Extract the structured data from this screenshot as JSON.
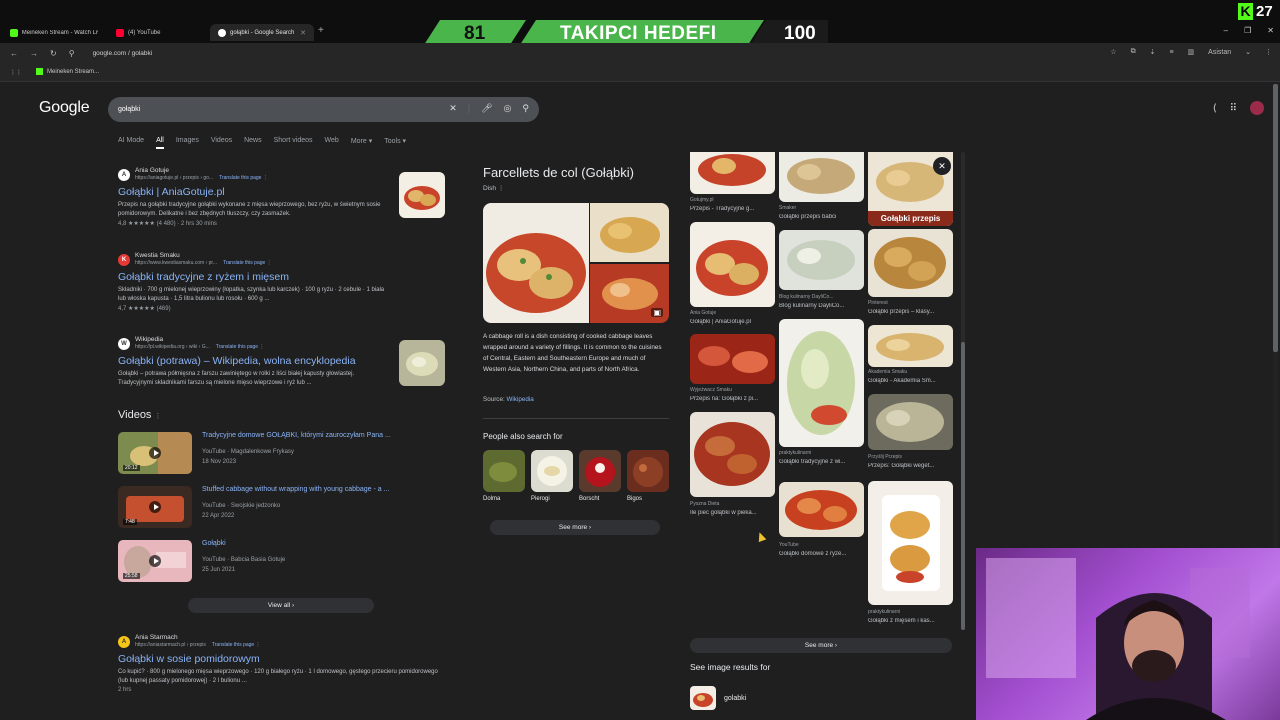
{
  "browser": {
    "tabs": [
      {
        "label": "Meineken Stream - Watch Liv"
      },
      {
        "label": "(4) YouTube"
      },
      {
        "label": "gołąbki - Google Search"
      }
    ],
    "url": "google.com / golabki",
    "bookmark": "Meineken Stream...",
    "assistant_label": "Asistan"
  },
  "overlay": {
    "goal_current": "81",
    "goal_text": "TAKIPCI HEDEFI",
    "goal_target": "100",
    "kick_count": "27"
  },
  "google": {
    "logo": "Google",
    "query": "gołąbki",
    "tabs": [
      "AI Mode",
      "All",
      "Images",
      "Videos",
      "News",
      "Short videos",
      "Web",
      "More ▾",
      "Tools ▾"
    ]
  },
  "results": [
    {
      "site": "Ania Gotuje",
      "url": "https://aniagotuje.pl › przepis › go...",
      "translate": "Translate this page",
      "title": "Gołąbki | AniaGotuje.pl",
      "snippet_lead": "Przepis na gołąbki tradycyjne gołąbki wykonane z mięsa wieprzowego, bez ryżu, w świetnym sosie pomidorowym. Delikatne i bez zbędnych tłuszczy, czy zasmażek.",
      "meta": "4,8 ★★★★★ (4 480) · 2 hrs 30 mins"
    },
    {
      "site": "Kwestia Smaku",
      "url": "https://www.kwestiasmaku.com › pr...",
      "translate": "Translate this page",
      "title": "Gołąbki tradycyjne z ryżem i mięsem",
      "snippet_lead": "Składniki · 700 g mielonej wieprzowiny (łopatka, szynka lub karczek) · 100 g ryżu · 2 cebule · 1 biała lub włoska kapusta · 1,5 litra bulionu lub rosołu · 600 g ...",
      "meta": "4,7 ★★★★★ (469)"
    },
    {
      "site": "Wikipedia",
      "url": "https://pl.wikipedia.org › wiki › G...",
      "translate": "Translate this page",
      "title": "Gołąbki (potrawa) – Wikipedia, wolna encyklopedia",
      "snippet_lead": "Gołąbki – potrawa półmięsna z farszu zawiniętego w rolki z liści białej kapusty głowiastej. Tradycyjnymi składnikami farszu są mielone mięso wieprzowe i ryż lub ...",
      "meta": ""
    }
  ],
  "videos": {
    "heading": "Videos",
    "items": [
      {
        "title": "Tradycyjne domowe GOŁĄBKI, którymi zauroczyłam Pana ...",
        "source": "YouTube · Magdalenkowe Frykasy",
        "date": "18 Nov 2023",
        "duration": "20:12"
      },
      {
        "title": "Stuffed cabbage without wrapping with young cabbage - a ...",
        "source": "YouTube · Swojskie jedzonko",
        "date": "22 Apr 2022",
        "duration": "7:48"
      },
      {
        "title": "Gołąbki",
        "source": "YouTube · Babcia Basia Gotuje",
        "date": "25 Jun 2021",
        "duration": "25:58"
      }
    ],
    "view_all": "View all ›"
  },
  "result4": {
    "site": "Ania Starmach",
    "url": "https://aniastarmach.pl › przepis",
    "translate": "Translate this page",
    "title": "Gołąbki w sosie pomidorowym",
    "snippet": "Co kupić? · 800 g mielonego mięsa wieprzowego · 120 g białego ryżu · 1 l domowego, gęstego przecieru pomidorowego (lub kupnej passaty pomidorowej) · 2 l bulionu ...",
    "meta": "2 hrs"
  },
  "knowledge_panel": {
    "title": "Farcellets de col (Gołąbki)",
    "subtitle": "Dish",
    "description": "A cabbage roll is a dish consisting of cooked cabbage leaves wrapped around a variety of fillings. It is common to the cuisines of Central, Eastern and Southeastern Europe and much of Western Asia, Northern China, and parts of North Africa.",
    "source_label": "Source:",
    "source_link": "Wikipedia",
    "people_also_search": "People also search for",
    "related": [
      "Dolma",
      "Pierogi",
      "Borscht",
      "Bigos"
    ],
    "see_more": "See more ›"
  },
  "image_grid": {
    "overlay_label": "Gołąbki przepis",
    "items": [
      {
        "src": "Gotujmy.pl",
        "cap": "Przepis - Tradycyjne g..."
      },
      {
        "src": "Smaker",
        "cap": "Gołąbki przepis babci"
      },
      {
        "src": "Pinterest",
        "cap": "Gołąbki przepis – klasy..."
      },
      {
        "src": "Ania Gotuje",
        "cap": "Gołąbki | AniaGotuje.pl"
      },
      {
        "src": "Blog kulinarny DayliCo...",
        "cap": "Blog kulinarny DayliCo..."
      },
      {
        "src": "Akademia Smaku",
        "cap": "Gołąbki - Akademia Sm..."
      },
      {
        "src": "Wyjeżwacz Smaku",
        "cap": "Przepis na: Gołąbki z pi..."
      },
      {
        "src": "praktykulinarni",
        "cap": "Gołąbki tradycyjne z wi..."
      },
      {
        "src": "Przyślij Przepis",
        "cap": "Przepis: Gołąbki weget..."
      },
      {
        "src": "Pyszna Dieta",
        "cap": "Ile piec gołąbki w piekа..."
      },
      {
        "src": "YouTube",
        "cap": "Gołąbki domowe z ryże..."
      },
      {
        "src": "praktykulinarni",
        "cap": "Gołąbki z mięsem i kas..."
      }
    ],
    "see_more": "See more ›",
    "see_image_results": "See image results for",
    "image_query": "golabki"
  },
  "colors": {
    "goal_green": "#4ab54a",
    "kick_green": "#53fc18",
    "link_blue": "#8ab4f8"
  }
}
